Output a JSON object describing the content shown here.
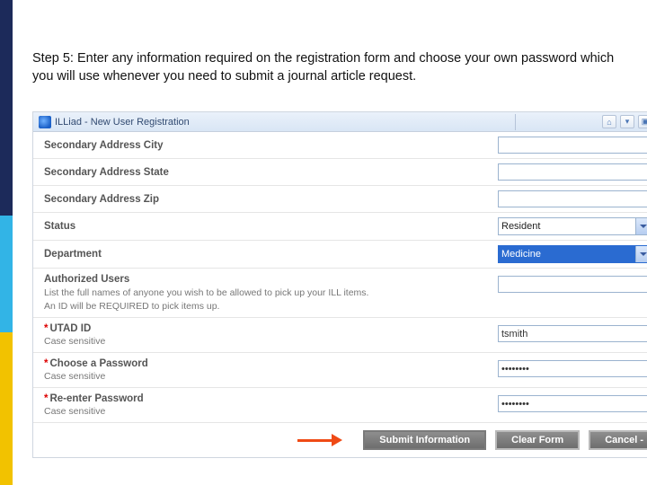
{
  "instruction": "Step 5: Enter any information required on the registration form and choose your own password which you will use whenever you need to submit a journal article request.",
  "browser": {
    "tab_title": "ILLiad - New User Registration"
  },
  "form": {
    "city_label": "Secondary Address City",
    "state_label": "Secondary Address State",
    "zip_label": "Secondary Address Zip",
    "status_label": "Status",
    "status_value": "Resident",
    "dept_label": "Department",
    "dept_value": "Medicine",
    "auth_label": "Authorized Users",
    "auth_help1": "List the full names of anyone you wish to be allowed to pick up your ILL items.",
    "auth_help2": "An ID will be REQUIRED to pick items up.",
    "utad_label": "UTAD ID",
    "utad_value": "tsmith",
    "case_note": "Case sensitive",
    "pw1_label": "Choose a Password",
    "pw1_value": "••••••••",
    "pw2_label": "Re-enter Password",
    "pw2_value": "••••••••"
  },
  "buttons": {
    "submit": "Submit Information",
    "clear": "Clear Form",
    "cancel": "Cancel -"
  }
}
